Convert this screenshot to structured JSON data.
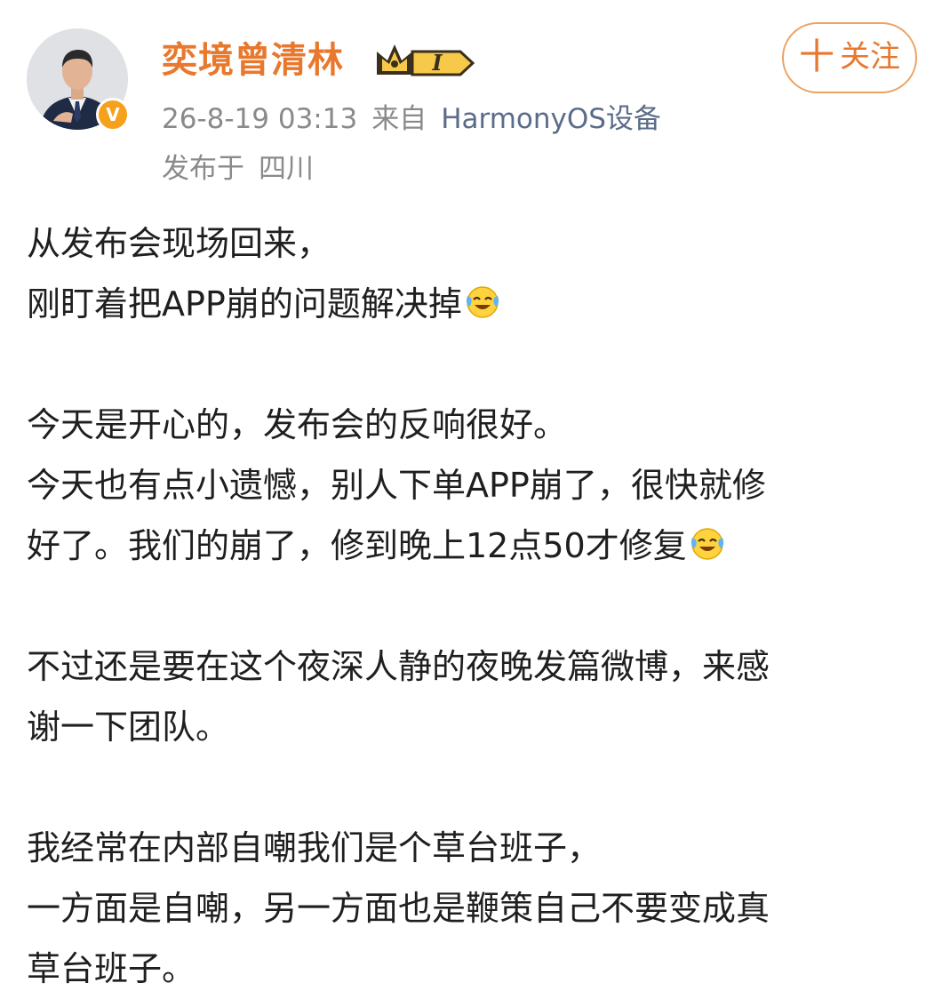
{
  "post": {
    "author": {
      "name": "奕境曾清林",
      "vip_level": "I",
      "verified_mark": "V"
    },
    "follow_button": {
      "plus": "十",
      "label": "关注"
    },
    "meta": {
      "timestamp": "26-8-19 03:13",
      "source_prefix": "来自",
      "device": "HarmonyOS设备",
      "location_prefix": "发布于",
      "location": "四川"
    },
    "paragraphs": [
      [
        "从发布会现场回来，",
        "刚盯着把APP崩的问题解决掉"
      ],
      [
        "今天是开心的，发布会的反响很好。",
        "今天也有点小遗憾，别人下单APP崩了，很快就修",
        "好了。我们的崩了，修到晚上12点50才修复"
      ],
      [
        "不过还是要在这个夜深人静的夜晚发篇微博，来感",
        "谢一下团队。"
      ],
      [
        "我经常在内部自嘲我们是个草台班子，",
        "一方面是自嘲，另一方面也是鞭策自己不要变成真",
        "草台班子。"
      ]
    ],
    "emoji": "laugh-cry-icon"
  },
  "colors": {
    "username": "#e8782d",
    "meta": "#8a8a8a",
    "device_link": "#5b6c8a",
    "follow_border": "#eca363",
    "verified": "#f5a11c",
    "body_text": "#1f1f1f"
  }
}
